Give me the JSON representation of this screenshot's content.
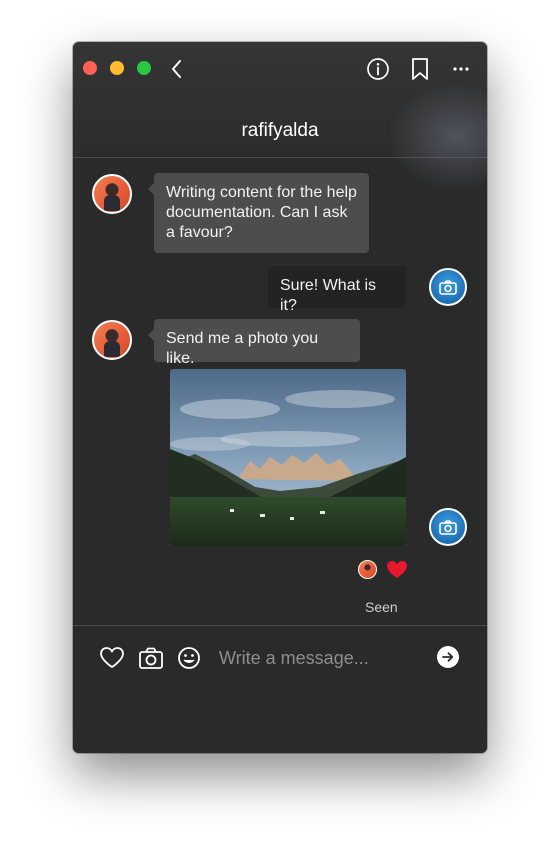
{
  "window": {
    "title": "rafifyalda",
    "controls": [
      "close",
      "minimize",
      "zoom"
    ],
    "toolbar_icons": [
      "back-icon",
      "info-icon",
      "bookmark-icon",
      "more-icon"
    ]
  },
  "conversation": {
    "messages": [
      {
        "from": "rafifyalda",
        "text": "Writing content for the help documentation. Can I ask a favour?"
      },
      {
        "from": "me",
        "text": "Sure! What is it?"
      },
      {
        "from": "rafifyalda",
        "text": "Send me a photo you like."
      },
      {
        "from": "me",
        "type": "photo",
        "description_icon": "mountain-landscape-photo"
      }
    ],
    "reaction": "heart",
    "status": "Seen"
  },
  "composer": {
    "placeholder": "Write a message...",
    "icons": [
      "heart-icon",
      "camera-icon",
      "emoji-icon",
      "send-icon"
    ]
  },
  "colors": {
    "window_bg": "#2a2a2a",
    "bubble_incoming": "#4d4d4d",
    "bubble_outgoing": "#232323",
    "reaction_heart": "#e5182f",
    "camera_avatar": "#1f6fb4"
  }
}
